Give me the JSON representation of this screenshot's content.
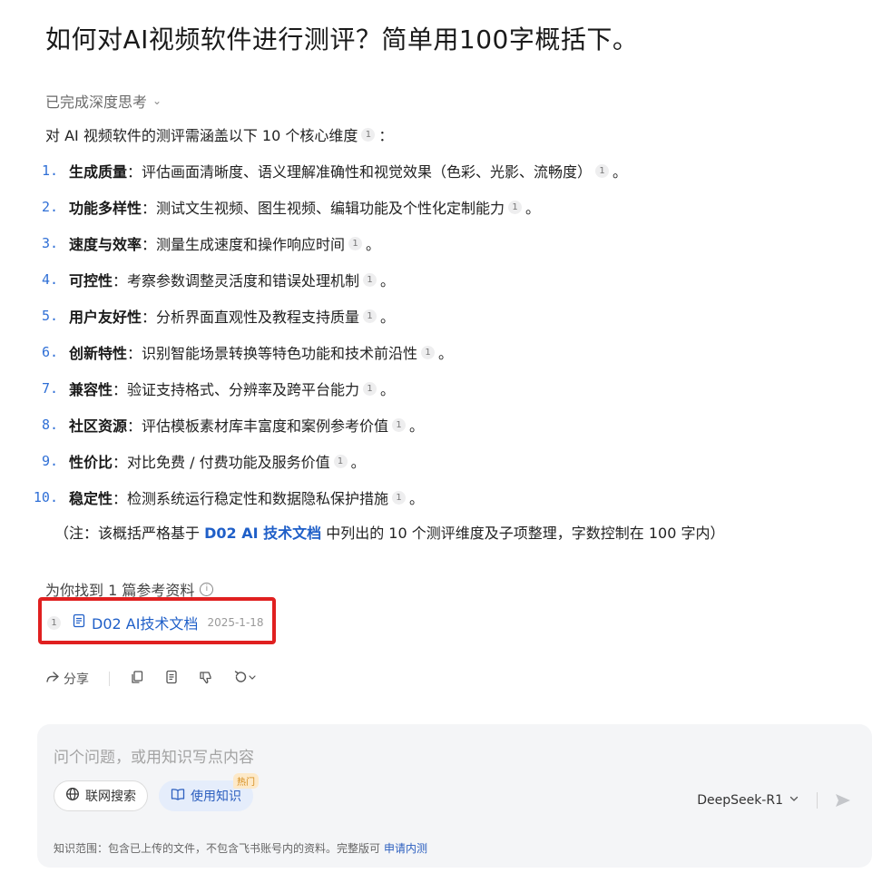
{
  "question": "如何对AI视频软件进行测评？简单用100字概括下。",
  "thinking_label": "已完成深度思考",
  "intro_text": "对 AI 视频软件的测评需涵盖以下 10 个核心维度",
  "intro_suffix": "：",
  "cite_label": "1",
  "items": [
    {
      "num": "1.",
      "name": "生成质量",
      "desc": "：评估画面清晰度、语义理解准确性和视觉效果（色彩、光影、流畅度）"
    },
    {
      "num": "2.",
      "name": "功能多样性",
      "desc": "：测试文生视频、图生视频、编辑功能及个性化定制能力"
    },
    {
      "num": "3.",
      "name": "速度与效率",
      "desc": "：测量生成速度和操作响应时间"
    },
    {
      "num": "4.",
      "name": "可控性",
      "desc": "：考察参数调整灵活度和错误处理机制"
    },
    {
      "num": "5.",
      "name": "用户友好性",
      "desc": "：分析界面直观性及教程支持质量"
    },
    {
      "num": "6.",
      "name": "创新特性",
      "desc": "：识别智能场景转换等特色功能和技术前沿性"
    },
    {
      "num": "7.",
      "name": "兼容性",
      "desc": "：验证支持格式、分辨率及跨平台能力"
    },
    {
      "num": "8.",
      "name": "社区资源",
      "desc": "：评估模板素材库丰富度和案例参考价值"
    },
    {
      "num": "9.",
      "name": "性价比",
      "desc": "：对比免费 / 付费功能及服务价值"
    },
    {
      "num": "10.",
      "name": "稳定性",
      "desc": "：检测系统运行稳定性和数据隐私保护措施"
    }
  ],
  "item_end": "。",
  "note": {
    "prefix": "（注：该概括严格基于 ",
    "doc": "D02 AI 技术文档",
    "suffix": " 中列出的 10 个测评维度及子项整理，字数控制在 100 字内）"
  },
  "refs": {
    "title": "为你找到 1 篇参考资料",
    "info_icon": "info-icon",
    "item": {
      "index": "1",
      "title": "D02 AI技术文档",
      "date": "2025-1-18"
    }
  },
  "actions": {
    "share_label": "分享"
  },
  "composer": {
    "placeholder": "问个问题，或用知识写点内容",
    "web_search_label": "联网搜索",
    "knowledge_label": "使用知识",
    "hot_badge": "热门",
    "model": "DeepSeek-R1",
    "footer_text": "知识范围：包含已上传的文件，不包含飞书账号内的资料。完整版可",
    "footer_link": "申请内测"
  },
  "colors": {
    "accent": "#1f5fc8",
    "highlight_box": "#e02020"
  }
}
